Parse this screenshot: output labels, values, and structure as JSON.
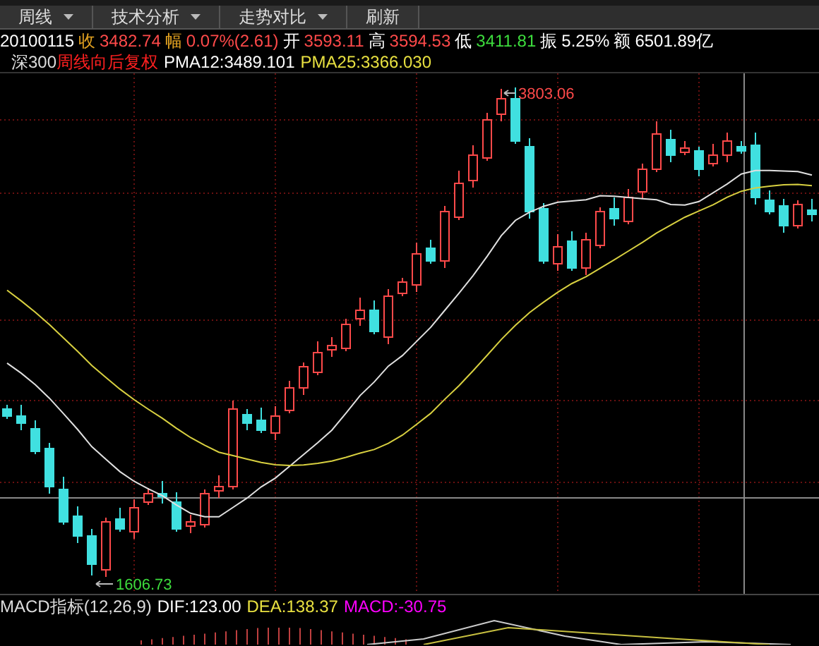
{
  "toolbar": {
    "buttons": [
      {
        "label": "周线",
        "dropdown": true
      },
      {
        "label": "技术分析",
        "dropdown": true
      },
      {
        "label": "走势对比",
        "dropdown": true
      },
      {
        "label": "刷新",
        "dropdown": false
      }
    ]
  },
  "quote": {
    "date": "20100115",
    "fields": [
      {
        "label": {
          "text": "收",
          "color": "#e0a020"
        },
        "value": {
          "text": "3482.74",
          "color": "#ff4a4a"
        }
      },
      {
        "label": {
          "text": "幅",
          "color": "#e0a020"
        },
        "value": {
          "text": "0.07%(2.61)",
          "color": "#ff4a4a"
        }
      },
      {
        "label": {
          "text": "开",
          "color": "#ffffff"
        },
        "value": {
          "text": "3593.11",
          "color": "#ff4a4a"
        }
      },
      {
        "label": {
          "text": "高",
          "color": "#ffffff"
        },
        "value": {
          "text": "3594.53",
          "color": "#ff4a4a"
        }
      },
      {
        "label": {
          "text": "低",
          "color": "#ffffff"
        },
        "value": {
          "text": "3411.81",
          "color": "#3ddc3d"
        }
      },
      {
        "label": {
          "text": "振",
          "color": "#ffffff"
        },
        "value": {
          "text": "5.25%",
          "color": "#ffffff"
        }
      },
      {
        "label": {
          "text": "额",
          "color": "#ffffff"
        },
        "value": {
          "text": "6501.89亿",
          "color": "#ffffff"
        }
      }
    ]
  },
  "legend": {
    "index_name": "深300",
    "adjust": "周线向后复权",
    "averages": [
      {
        "text": "PMA12:3489.101",
        "color": "#ffffff"
      },
      {
        "text": "PMA25:3366.030",
        "color": "#e8e040"
      }
    ]
  },
  "chart": {
    "high_label": "3803.06",
    "low_label": "1606.73"
  },
  "macd": {
    "title": "MACD指标(12,26,9)",
    "values": [
      {
        "text": "DIF:123.00",
        "color": "#ffffff"
      },
      {
        "text": "DEA:138.37",
        "color": "#e8e040"
      },
      {
        "text": "MACD:-30.75",
        "color": "#ff00ff"
      }
    ]
  }
}
